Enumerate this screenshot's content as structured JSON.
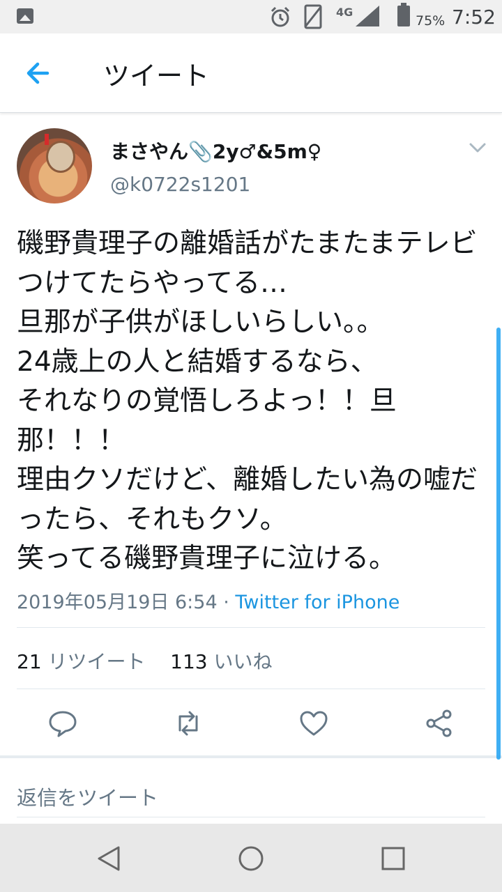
{
  "status_bar": {
    "network": "4G",
    "battery": "75%",
    "time": "7:52",
    "icons": [
      "image-icon",
      "alarm-icon",
      "vibrate-icon",
      "signal-icon",
      "battery-icon"
    ]
  },
  "header": {
    "back_icon": "arrow-left-icon",
    "title": "ツイート"
  },
  "tweet": {
    "display_name": "まさやん📎2y♂&5m♀",
    "handle": "@k0722s1201",
    "text": "磯野貴理子の離婚話がたまたまテレビつけてたらやってる…\n旦那が子供がほしいらしい。。\n24歳上の人と結婚するなら、\nそれなりの覚悟しろよっ！！旦那！！！\n理由クソだけど、離婚したい為の嘘だったら、それもクソ。\n笑ってる磯野貴理子に泣ける。",
    "date": "2019年05月19日 6:54",
    "separator": " · ",
    "source": "Twitter for iPhone",
    "retweet_count": "21",
    "retweet_label": "リツイート",
    "like_count": "113",
    "like_label": "いいね"
  },
  "actions": [
    "reply-icon",
    "retweet-icon",
    "like-icon",
    "share-icon"
  ],
  "reply_placeholder": "返信をツイート",
  "colors": {
    "accent": "#1da1f2",
    "link": "#1b95e0",
    "secondary_text": "#657786",
    "primary_text": "#14171a"
  }
}
